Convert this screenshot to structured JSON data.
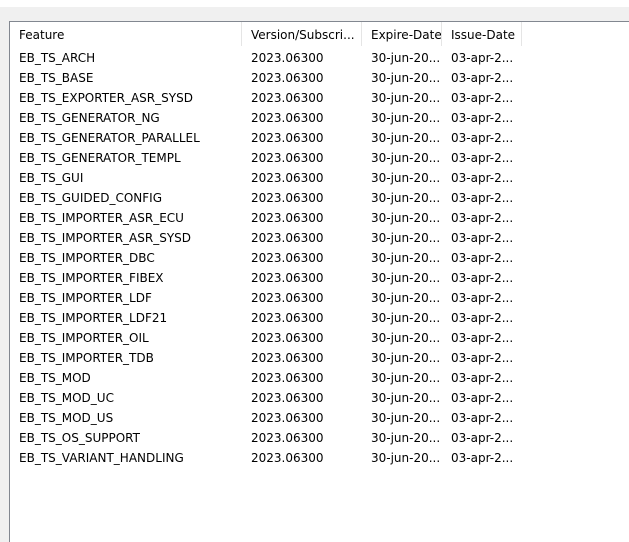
{
  "columns": [
    "Feature",
    "Version/Subscri...",
    "Expire-Date",
    "Issue-Date"
  ],
  "rows": [
    [
      "EB_TS_ARCH",
      "2023.06300",
      "30-jun-20...",
      "03-apr-2..."
    ],
    [
      "EB_TS_BASE",
      "2023.06300",
      "30-jun-20...",
      "03-apr-2..."
    ],
    [
      "EB_TS_EXPORTER_ASR_SYSD",
      "2023.06300",
      "30-jun-20...",
      "03-apr-2..."
    ],
    [
      "EB_TS_GENERATOR_NG",
      "2023.06300",
      "30-jun-20...",
      "03-apr-2..."
    ],
    [
      "EB_TS_GENERATOR_PARALLEL",
      "2023.06300",
      "30-jun-20...",
      "03-apr-2..."
    ],
    [
      "EB_TS_GENERATOR_TEMPL",
      "2023.06300",
      "30-jun-20...",
      "03-apr-2..."
    ],
    [
      "EB_TS_GUI",
      "2023.06300",
      "30-jun-20...",
      "03-apr-2..."
    ],
    [
      "EB_TS_GUIDED_CONFIG",
      "2023.06300",
      "30-jun-20...",
      "03-apr-2..."
    ],
    [
      "EB_TS_IMPORTER_ASR_ECU",
      "2023.06300",
      "30-jun-20...",
      "03-apr-2..."
    ],
    [
      "EB_TS_IMPORTER_ASR_SYSD",
      "2023.06300",
      "30-jun-20...",
      "03-apr-2..."
    ],
    [
      "EB_TS_IMPORTER_DBC",
      "2023.06300",
      "30-jun-20...",
      "03-apr-2..."
    ],
    [
      "EB_TS_IMPORTER_FIBEX",
      "2023.06300",
      "30-jun-20...",
      "03-apr-2..."
    ],
    [
      "EB_TS_IMPORTER_LDF",
      "2023.06300",
      "30-jun-20...",
      "03-apr-2..."
    ],
    [
      "EB_TS_IMPORTER_LDF21",
      "2023.06300",
      "30-jun-20...",
      "03-apr-2..."
    ],
    [
      "EB_TS_IMPORTER_OIL",
      "2023.06300",
      "30-jun-20...",
      "03-apr-2..."
    ],
    [
      "EB_TS_IMPORTER_TDB",
      "2023.06300",
      "30-jun-20...",
      "03-apr-2..."
    ],
    [
      "EB_TS_MOD",
      "2023.06300",
      "30-jun-20...",
      "03-apr-2..."
    ],
    [
      "EB_TS_MOD_UC",
      "2023.06300",
      "30-jun-20...",
      "03-apr-2..."
    ],
    [
      "EB_TS_MOD_US",
      "2023.06300",
      "30-jun-20...",
      "03-apr-2..."
    ],
    [
      "EB_TS_OS_SUPPORT",
      "2023.06300",
      "30-jun-20...",
      "03-apr-2..."
    ],
    [
      "EB_TS_VARIANT_HANDLING",
      "2023.06300",
      "30-jun-20...",
      "03-apr-2..."
    ]
  ]
}
